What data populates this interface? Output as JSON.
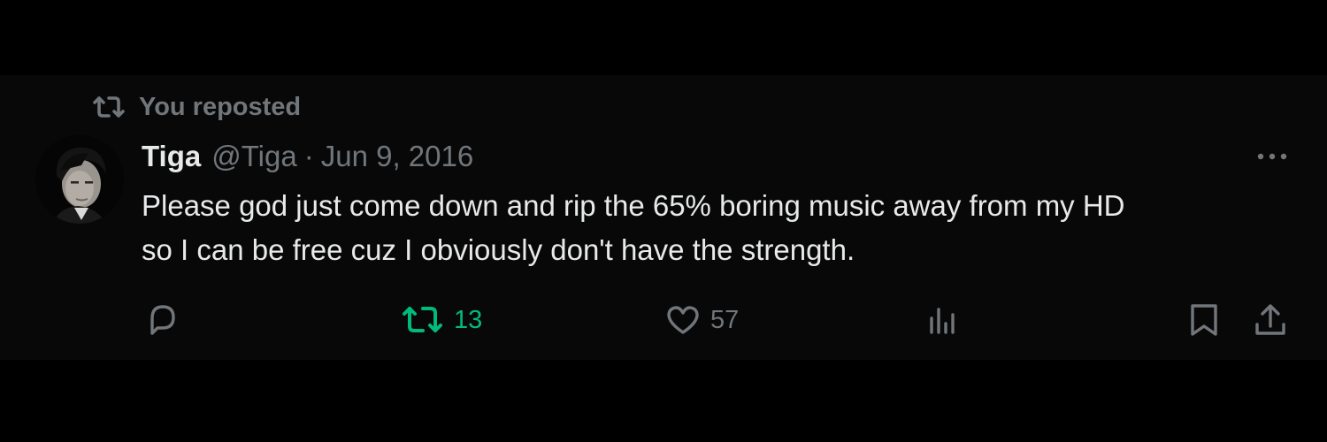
{
  "repost": {
    "icon": "repost-icon",
    "label": "You reposted"
  },
  "author": {
    "avatar": "avatar",
    "name": "Tiga",
    "handle": "@Tiga",
    "separator": "·",
    "date": "Jun 9, 2016"
  },
  "more_icon": "more-icon",
  "post": {
    "line1": "Please god just come down and rip the 65% boring music away from my HD",
    "line2": "so I can be free cuz I obviously don't have the strength."
  },
  "actions": {
    "reply": {
      "icon": "reply-icon",
      "count": ""
    },
    "repost": {
      "icon": "repost-icon",
      "count": "13",
      "active": true,
      "color": "#00ba7c"
    },
    "like": {
      "icon": "heart-icon",
      "count": "57"
    },
    "views": {
      "icon": "views-icon",
      "count": ""
    },
    "bookmark": {
      "icon": "bookmark-icon"
    },
    "share": {
      "icon": "share-icon"
    }
  },
  "colors": {
    "background": "#000000",
    "text": "#e7e9ea",
    "secondary": "#71767b",
    "repost_active": "#00ba7c"
  }
}
